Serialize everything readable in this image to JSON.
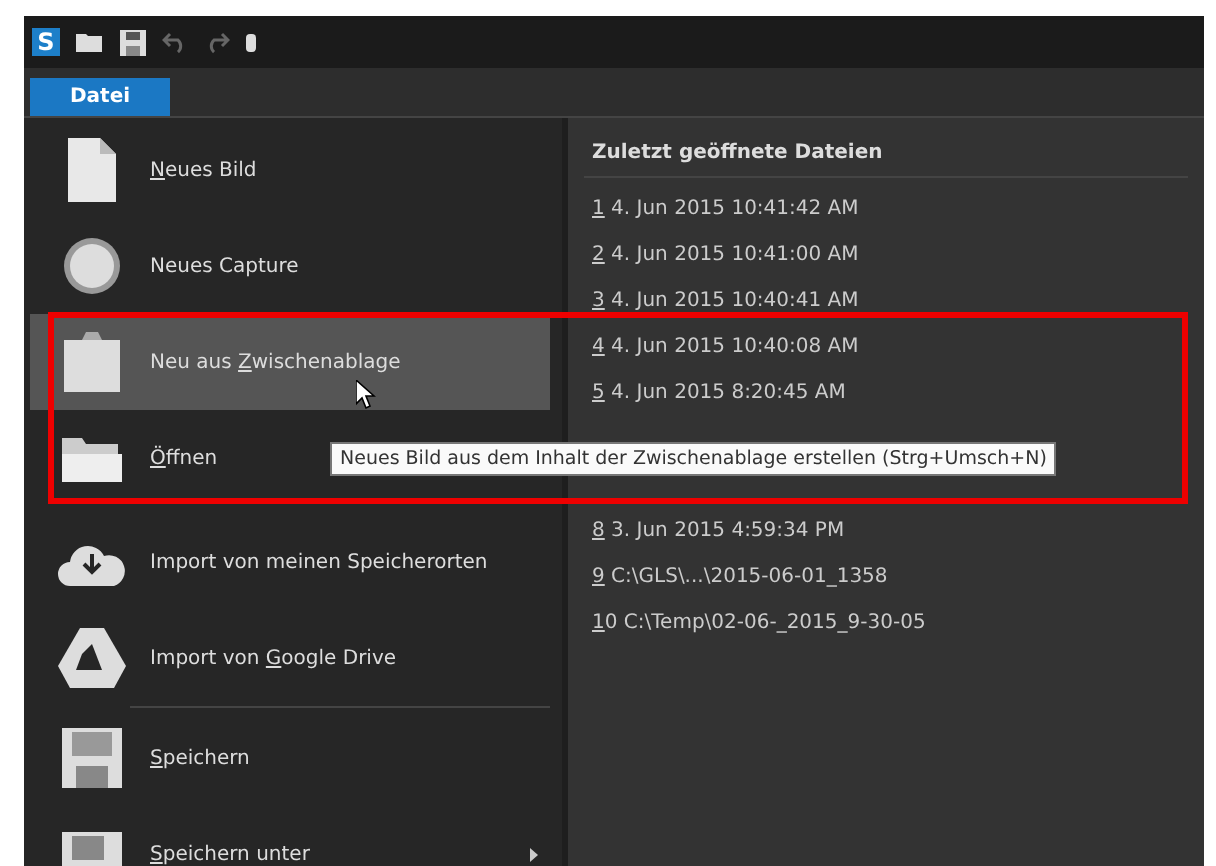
{
  "toolbar": {
    "logo": "S",
    "undo_disabled": true,
    "redo_disabled": true
  },
  "tabs": [
    {
      "label": "Datei",
      "selected": true
    }
  ],
  "menu": [
    {
      "kind": "page",
      "key": "N",
      "after": "eues Bild",
      "selected": false
    },
    {
      "kind": "circle",
      "label": "Neues Capture",
      "selected": false
    },
    {
      "kind": "clipboard",
      "before": "Neu aus ",
      "key": "Z",
      "after": "wischenablage",
      "selected": true
    },
    {
      "kind": "folder",
      "key": "Ö",
      "after": "ffnen",
      "selected": false
    },
    {
      "kind": "cloud",
      "label": "Import von meinen Speicherorten",
      "selected": false,
      "gap_before": true
    },
    {
      "kind": "drive",
      "before": "Import von ",
      "key": "G",
      "after": "oogle Drive",
      "selected": false
    },
    {
      "kind": "disk",
      "key": "S",
      "after": "peichern",
      "selected": false,
      "divider_before": true
    },
    {
      "kind": "disk-as",
      "key": "S",
      "after": "peichern unter",
      "selected": false,
      "submenu": true
    }
  ],
  "recent": {
    "title": "Zuletzt geöffnete Dateien",
    "items": [
      {
        "key": "1",
        "text": "4. Jun 2015 10:41:42 AM"
      },
      {
        "key": "2",
        "text": "4. Jun 2015 10:41:00 AM"
      },
      {
        "key": "3",
        "text": "4. Jun 2015 10:40:41 AM"
      },
      {
        "key": "4",
        "text": "4. Jun 2015 10:40:08 AM"
      },
      {
        "key": "5",
        "text": "4. Jun 2015 8:20:45 AM"
      },
      {
        "key": "8",
        "text": "3. Jun 2015 4:59:34 PM",
        "hidden_gap_before": true
      },
      {
        "key": "9",
        "text": "C:\\GLS\\...\\2015-06-01_1358"
      },
      {
        "key": "1",
        "after_key": "0",
        "text": "C:\\Temp\\02-06-_2015_9-30-05"
      }
    ]
  },
  "tooltip": "Neues Bild aus dem Inhalt der Zwischenablage erstellen (Strg+Umsch+N)",
  "highlight_frame": true
}
